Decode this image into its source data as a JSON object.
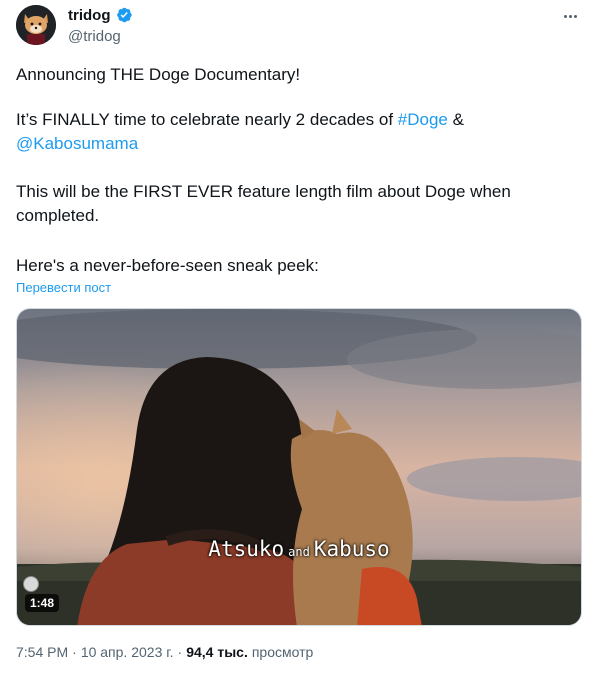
{
  "author": {
    "display_name": "tridog",
    "handle": "@tridog",
    "verified": true,
    "avatar_icon": "shiba-avatar-icon"
  },
  "tweet": {
    "line1": "Announcing THE Doge Documentary!",
    "line2_pre": "It’s FINALLY time to celebrate nearly 2 decades of ",
    "hashtag": "#Doge",
    "line2_amp": " &",
    "mention": "@Kabosumama",
    "line3": "This will be the FIRST EVER feature length film about Doge when completed.",
    "line4": "Here's a never-before-seen sneak peek:",
    "translate": "Перевести пост"
  },
  "video": {
    "subtitle_left": "Atsuko",
    "subtitle_mid": "and",
    "subtitle_right": "Kabuso",
    "duration": "1:48"
  },
  "meta": {
    "time": "7:54 PM",
    "sep1": "·",
    "date": "10 апр. 2023 г.",
    "sep2": "·",
    "views_count": "94,4 тыс.",
    "views_label": "просмотр"
  },
  "colors": {
    "link": "#1d9bf0",
    "secondary": "#536471",
    "verified": "#1d9bf0"
  }
}
